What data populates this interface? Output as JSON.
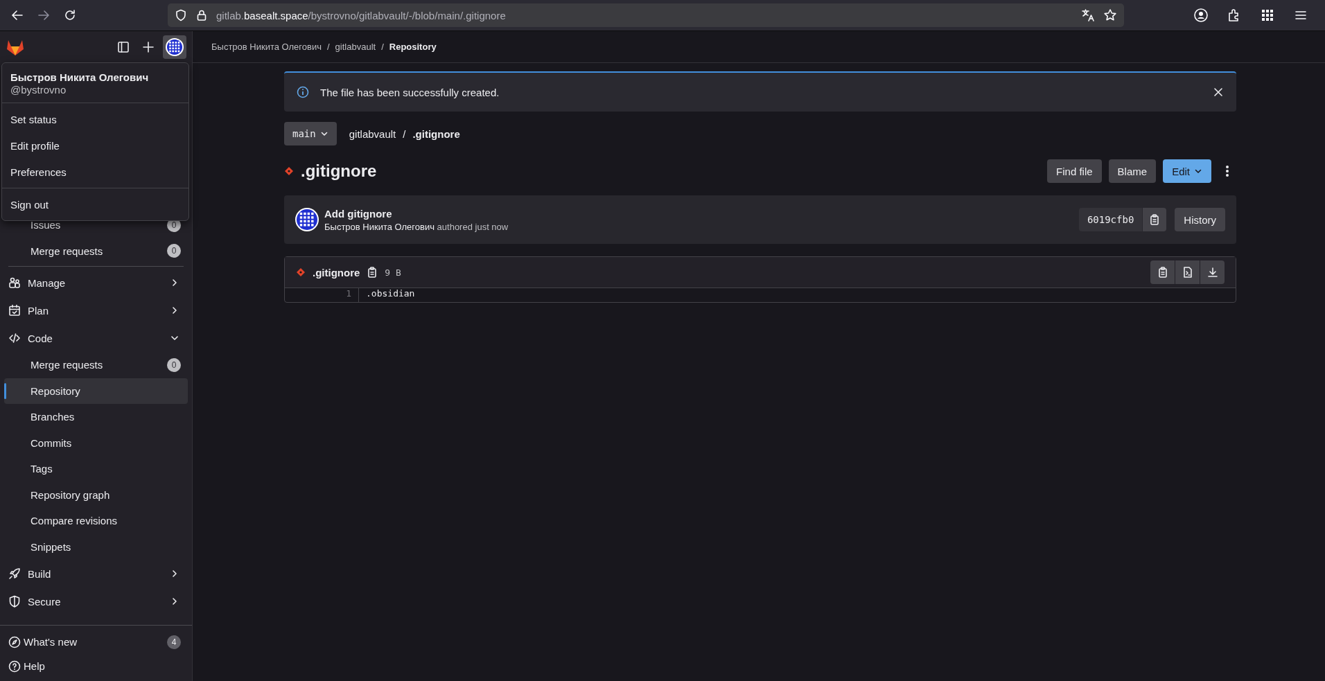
{
  "browser": {
    "url": {
      "prefix": "gitlab.",
      "domain": "basealt.space",
      "path": "/bystrovno/gitlabvault/-/blob/main/.gitignore"
    }
  },
  "sidebar": {
    "pinned": [
      {
        "label": "Issues",
        "badge": "0",
        "selected": false
      },
      {
        "label": "Merge requests",
        "badge": "0",
        "selected": false
      }
    ],
    "nav": [
      {
        "label": "Manage",
        "expanded": false
      },
      {
        "label": "Plan",
        "expanded": false
      },
      {
        "label": "Code",
        "expanded": true,
        "children": [
          {
            "label": "Merge requests",
            "badge": "0",
            "selected": false
          },
          {
            "label": "Repository",
            "selected": true
          },
          {
            "label": "Branches",
            "selected": false
          },
          {
            "label": "Commits",
            "selected": false
          },
          {
            "label": "Tags",
            "selected": false
          },
          {
            "label": "Repository graph",
            "selected": false
          },
          {
            "label": "Compare revisions",
            "selected": false
          },
          {
            "label": "Snippets",
            "selected": false
          }
        ]
      },
      {
        "label": "Build",
        "expanded": false
      },
      {
        "label": "Secure",
        "expanded": false
      }
    ],
    "footer": [
      {
        "label": "What's new",
        "badge": "4"
      },
      {
        "label": "Help"
      }
    ]
  },
  "user_menu": {
    "name": "Быстров Никита Олегович",
    "username": "@bystrovno",
    "groups": [
      [
        "Set status",
        "Edit profile",
        "Preferences"
      ],
      [
        "Sign out"
      ]
    ]
  },
  "breadcrumbs": [
    {
      "label": "Быстров Никита Олегович"
    },
    {
      "separator": "/",
      "label": "gitlabvault"
    },
    {
      "separator": "/",
      "label": "Repository"
    }
  ],
  "alert": {
    "message": "The file has been successfully created."
  },
  "branch": "main",
  "path": [
    {
      "label": "gitlabvault"
    },
    {
      "separator": "/",
      "label": ".gitignore"
    }
  ],
  "title": ".gitignore",
  "actions": [
    {
      "label": "Find file",
      "kind": "default"
    },
    {
      "label": "Blame",
      "kind": "default"
    },
    {
      "label": "Edit",
      "kind": "primary"
    }
  ],
  "commit": {
    "title": "Add gitignore",
    "author": "Быстров Никита Олегович",
    "meta": "authored just now",
    "sha": "6019cfb0",
    "history": "History"
  },
  "file": {
    "name": ".gitignore",
    "size": "9 B",
    "lines": [
      {
        "number": "1",
        "text": ".obsidian"
      }
    ]
  }
}
